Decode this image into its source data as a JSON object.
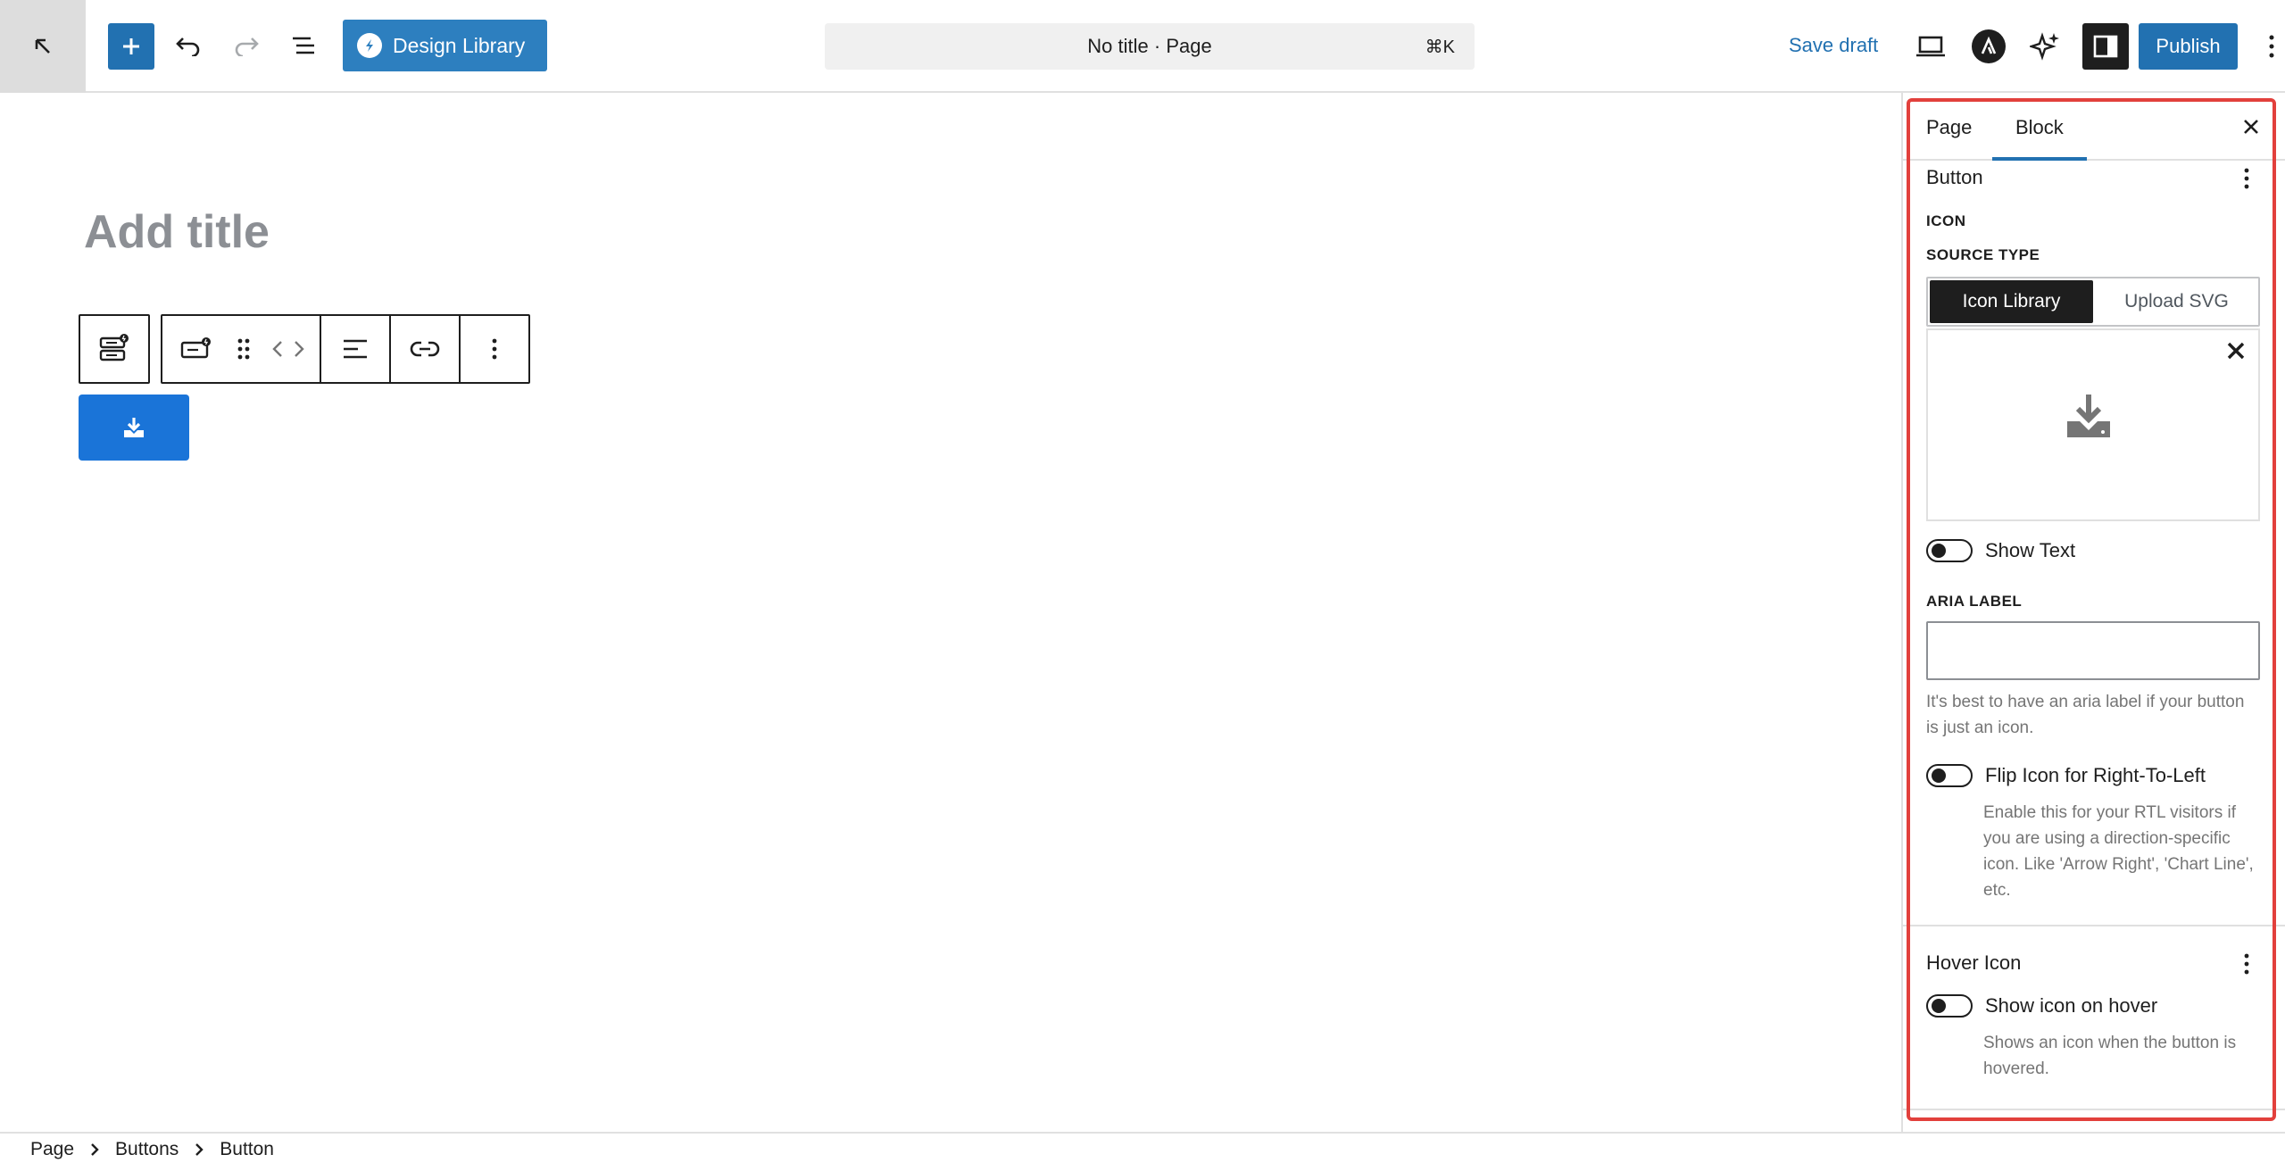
{
  "topbar": {
    "design_library_label": "Design Library",
    "document_title": "No title · Page",
    "shortcut": "⌘K",
    "save_draft_label": "Save draft",
    "publish_label": "Publish"
  },
  "editor": {
    "title_placeholder": "Add title"
  },
  "sidebar": {
    "tabs": [
      {
        "label": "Page",
        "active": false
      },
      {
        "label": "Block",
        "active": true
      }
    ],
    "button_panel_title": "Button",
    "icon_caption": "ICON",
    "source_type_caption": "SOURCE TYPE",
    "source_type_options": [
      {
        "label": "Icon Library",
        "selected": true
      },
      {
        "label": "Upload SVG",
        "selected": false
      }
    ],
    "selected_icon": "download-icon",
    "show_text": {
      "label": "Show Text",
      "checked": false
    },
    "aria_label_caption": "ARIA LABEL",
    "aria_label_value": "",
    "aria_help": "It's best to have an aria label if your button is just an icon.",
    "flip_icon": {
      "label": "Flip Icon for Right-To-Left",
      "checked": false,
      "help": "Enable this for your RTL visitors if you are using a direction-specific icon. Like 'Arrow Right', 'Chart Line', etc."
    },
    "hover_panel_title": "Hover Icon",
    "show_icon_on_hover": {
      "label": "Show icon on hover",
      "checked": false,
      "help": "Shows an icon when the button is hovered."
    }
  },
  "breadcrumb": [
    "Page",
    "Buttons",
    "Button"
  ],
  "colors": {
    "accent": "#2271b1",
    "button_blue": "#1a74d8",
    "highlight_border": "#e2403c"
  }
}
